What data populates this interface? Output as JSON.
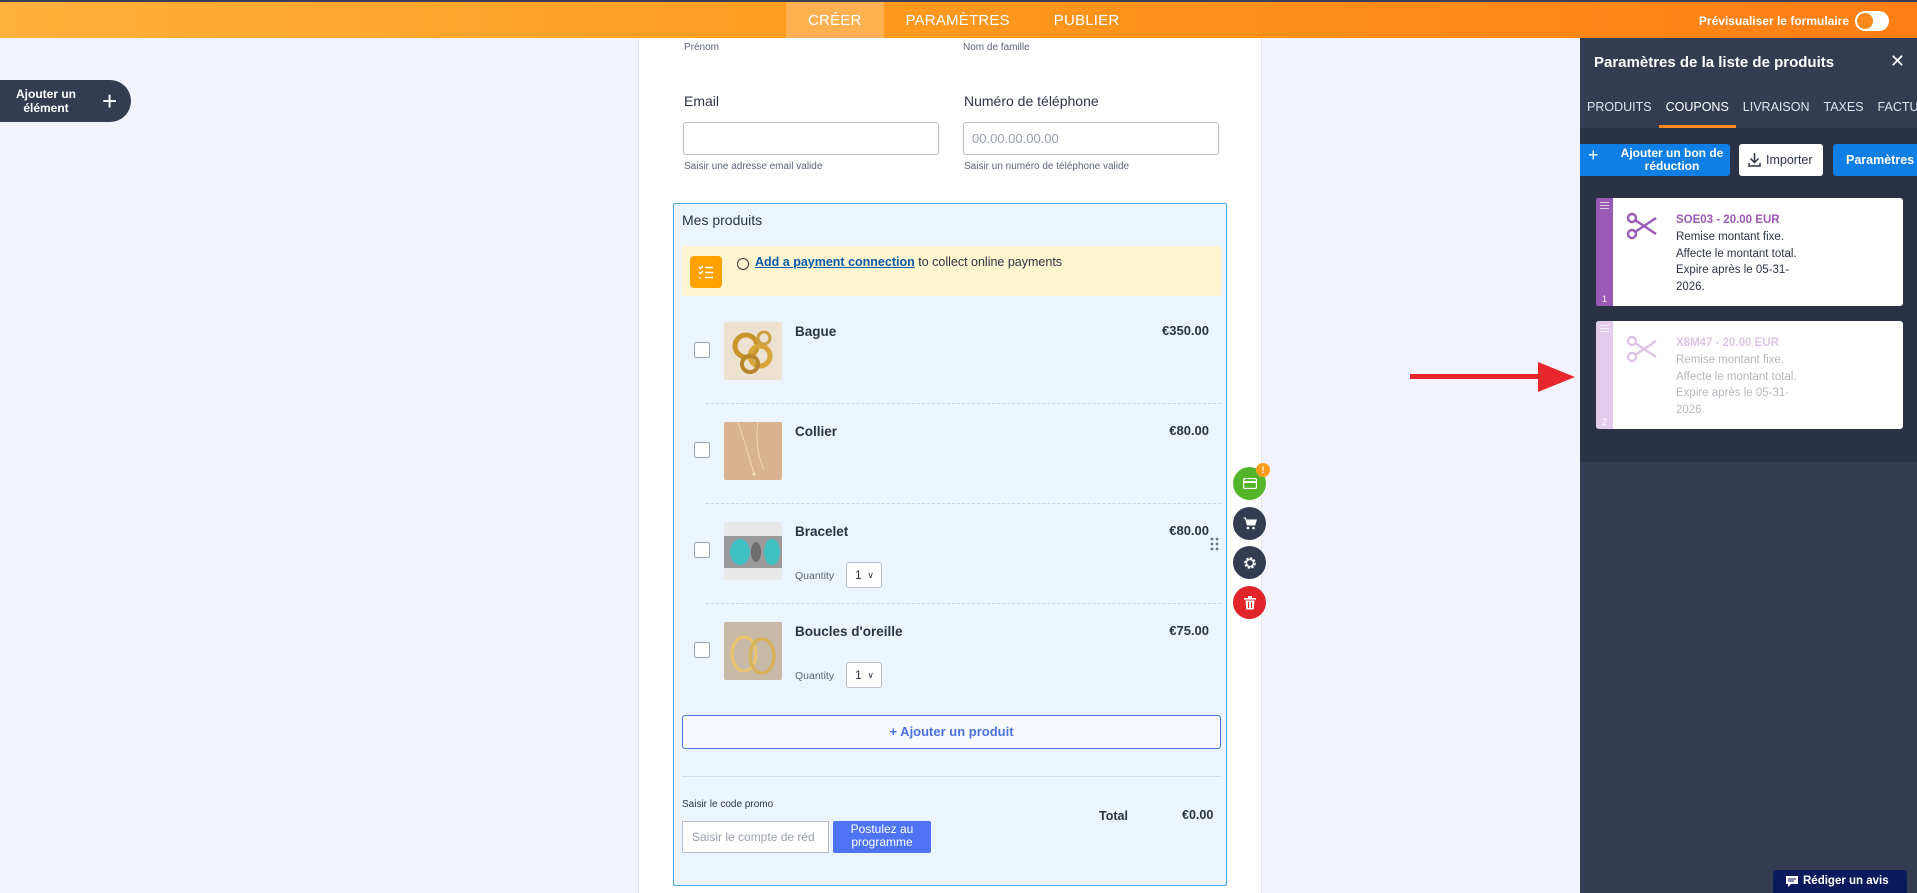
{
  "topbar": {
    "tabs": [
      {
        "label": "CRÉER",
        "active": true
      },
      {
        "label": "PARAMÈTRES",
        "active": false
      },
      {
        "label": "PUBLIER",
        "active": false
      }
    ],
    "preview_label": "Prévisualiser le formulaire",
    "preview_enabled": false
  },
  "add_element": {
    "label": "Ajouter un élément",
    "icon": "plus-icon"
  },
  "form": {
    "first_name_sublabel": "Prénom",
    "last_name_sublabel": "Nom de famille",
    "email": {
      "label": "Email",
      "value": "",
      "hint": "Saisir une adresse email valide"
    },
    "phone": {
      "label": "Numéro de téléphone",
      "placeholder": "00.00.00.00.00",
      "hint": "Saisir un numéro de téléphone valide"
    },
    "products": {
      "title": "Mes produits",
      "payment_banner": {
        "link_text": "Add a payment connection",
        "text": " to collect online payments"
      },
      "items": [
        {
          "name": "Bague",
          "price": "€350.00",
          "has_quantity": false
        },
        {
          "name": "Collier",
          "price": "€80.00",
          "has_quantity": false
        },
        {
          "name": "Bracelet",
          "price": "€80.00",
          "has_quantity": true,
          "quantity_label": "Quantity",
          "quantity": "1"
        },
        {
          "name": "Boucles d'oreille",
          "price": "€75.00",
          "has_quantity": true,
          "quantity_label": "Quantity",
          "quantity": "1"
        }
      ],
      "add_product_label": "+ Ajouter un produit",
      "promo_label": "Saisir le code promo",
      "promo_placeholder": "Saisir le compte de réd",
      "promo_button": "Postulez au programme",
      "total_label": "Total",
      "total_value": "€0.00"
    }
  },
  "fab": {
    "badge": "!"
  },
  "panel": {
    "title": "Paramètres de la liste de produits",
    "tabs": [
      {
        "label": "PRODUITS",
        "active": false
      },
      {
        "label": "COUPONS",
        "active": true
      },
      {
        "label": "LIVRAISON",
        "active": false
      },
      {
        "label": "TAXES",
        "active": false
      },
      {
        "label": "FACTURE",
        "active": false
      }
    ],
    "add_coupon_label": "Ajouter un bon de réduction",
    "import_label": "Importer",
    "settings_label": "Paramètres",
    "coupons": [
      {
        "number": "1",
        "title": "SOE03 - 20.00 EUR",
        "line1": "Remise montant fixe.",
        "line2": "Affecte le montant total.",
        "line3": "Expire après le 05-31-",
        "line4": "2026.",
        "color": "#9b59b6",
        "faded": false
      },
      {
        "number": "2",
        "title": "X8M47 - 20.00 EUR",
        "line1": "Remise montant fixe.",
        "line2": "Affecte le montant total.",
        "line3": "Expire après le 05-31-",
        "line4": "2026.",
        "color": "#9b59b6",
        "faded": true
      }
    ]
  },
  "review_label": "Rédiger un avis",
  "colors": {
    "accent_orange": "#ff8a1c",
    "panel_bg": "#343c52",
    "primary_blue": "#0f7fe6",
    "arrow_red": "#e8272c",
    "coupon_purple": "#9b59b6"
  }
}
